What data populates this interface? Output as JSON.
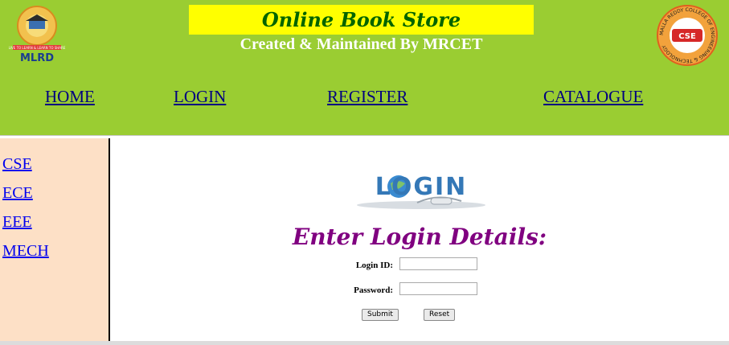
{
  "header": {
    "title": "Online Book Store",
    "subtitle": "Created & Maintained By MRCET",
    "logo_left": {
      "text_top": "LIVE TO LEARN & LEARN TO SHARE",
      "text_bottom": "MLRD"
    },
    "logo_right": {
      "text_ring": "MALLA REDDY COLLEGE OF ENGINEERING & TECHNOLOGY",
      "text_center": "CSE"
    }
  },
  "nav": {
    "home": "HOME",
    "login": "LOGIN",
    "register": "REGISTER",
    "catalogue": "CATALOGUE"
  },
  "sidebar": {
    "items": [
      "CSE",
      "ECE",
      "EEE",
      "MECH"
    ]
  },
  "main": {
    "login_logo_text": "LOGIN",
    "heading": "Enter Login Details:",
    "login_id_label": "Login ID:",
    "password_label": "Password:",
    "submit_label": "Submit",
    "reset_label": "Reset"
  },
  "colors": {
    "header_bg": "#9acd32",
    "title_box": "#ffff00",
    "title_text": "#006400",
    "sidebar_bg": "#fde0c6",
    "heading": "#800080",
    "link": "#0000ee"
  }
}
